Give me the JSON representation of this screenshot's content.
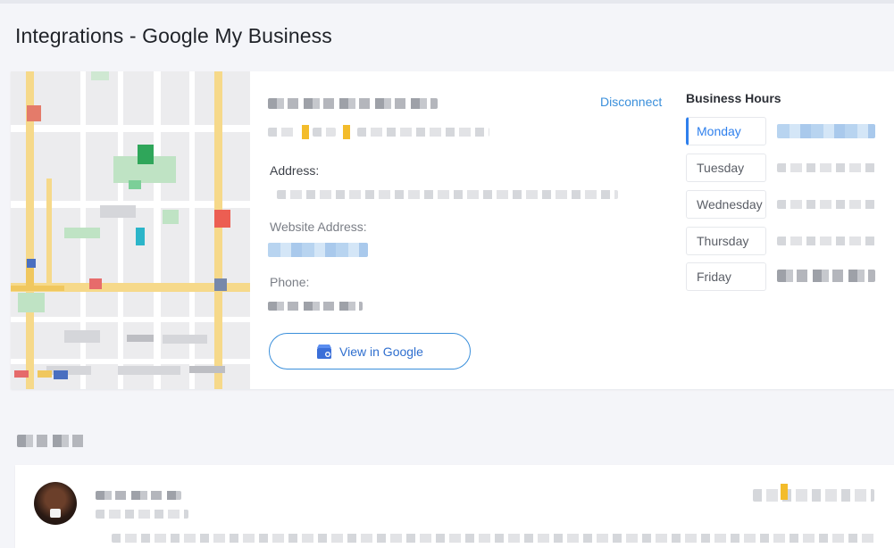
{
  "page": {
    "title": "Integrations - Google My Business"
  },
  "business": {
    "disconnect_label": "Disconnect",
    "address_label": "Address:",
    "website_label": "Website Address:",
    "phone_label": "Phone:",
    "view_button_label": "View in Google"
  },
  "hours": {
    "title": "Business Hours",
    "days": [
      "Monday",
      "Tuesday",
      "Wednesday",
      "Thursday",
      "Friday"
    ],
    "active_day": "Monday"
  },
  "colors": {
    "accent": "#3a8fdb",
    "active_day": "#2f80ed",
    "star": "#f3bc2b",
    "background": "#f4f5f9"
  }
}
